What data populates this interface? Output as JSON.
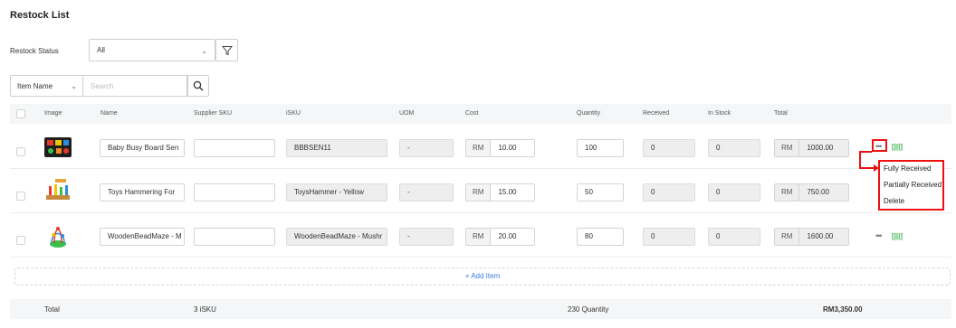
{
  "page": {
    "title": "Restock List"
  },
  "filters": {
    "status_label": "Restock Status",
    "status_value": "All",
    "search_field": "Item Name",
    "search_placeholder": "Search"
  },
  "columns": [
    "Image",
    "Name",
    "Supplier SKU",
    "iSKU",
    "UOM",
    "Cost",
    "Quantity",
    "Received",
    "In Stock",
    "Total"
  ],
  "rows": [
    {
      "image": "busy-board",
      "name": "Baby Busy Board Sen",
      "supplier_sku": "",
      "isku": "BBBSEN11",
      "uom": "-",
      "cost_prefix": "RM",
      "cost": "10.00",
      "quantity": "100",
      "received": "0",
      "in_stock": "0",
      "total_prefix": "RM",
      "total": "1000.00"
    },
    {
      "image": "hammer-toy",
      "name": "Toys Hammering For",
      "supplier_sku": "",
      "isku": "ToysHammer - Yellow",
      "uom": "-",
      "cost_prefix": "RM",
      "cost": "15.00",
      "quantity": "50",
      "received": "0",
      "in_stock": "0",
      "total_prefix": "RM",
      "total": "750.00"
    },
    {
      "image": "bead-maze",
      "name": "WoodenBeadMaze - M",
      "supplier_sku": "",
      "isku": "WoodenBeadMaze - Mushr",
      "uom": "-",
      "cost_prefix": "RM",
      "cost": "20.00",
      "quantity": "80",
      "received": "0",
      "in_stock": "0",
      "total_prefix": "RM",
      "total": "1600.00"
    }
  ],
  "row_actions": {
    "more": "•••",
    "barcode": "[|||]"
  },
  "dropdown": [
    "Fully Received",
    "Partially Received",
    "Delete"
  ],
  "add_item": "+ Add Item",
  "footer": {
    "label": "Total",
    "isku_count": "3 iSKU",
    "quantity": "230 Quantity",
    "total": "RM3,350.00"
  },
  "colors": {
    "accent": "#3b7de0",
    "highlight": "#e11111",
    "barcode": "#3cb44a"
  }
}
